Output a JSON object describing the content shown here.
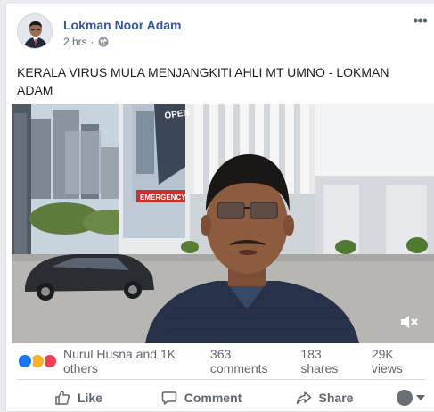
{
  "post": {
    "author": "Lokman Noor Adam",
    "time": "2 hrs",
    "privacy_icon": "globe-icon",
    "more_icon": "more-options-icon",
    "text": "KERALA VIRUS MULA MENJANGKITI AHLI MT UMNO - LOKMAN ADAM"
  },
  "video": {
    "sign_text": "OPEN",
    "sign_text_2": "EMERGENCY",
    "volume_icon": "speaker-muted-icon"
  },
  "stats": {
    "reactions": [
      "like-reaction-icon",
      "haha-reaction-icon",
      "love-reaction-icon"
    ],
    "reactor_text": "Nurul Husna and 1K others",
    "comments": "363 comments",
    "shares": "183 shares",
    "views": "29K views"
  },
  "actions": {
    "like": "Like",
    "comment": "Comment",
    "share": "Share"
  },
  "colors": {
    "author_link": "#385898",
    "like_blue": "#1877f2",
    "love_red": "#f33e58",
    "haha_yellow": "#f7b125",
    "muted_text": "#606770"
  }
}
